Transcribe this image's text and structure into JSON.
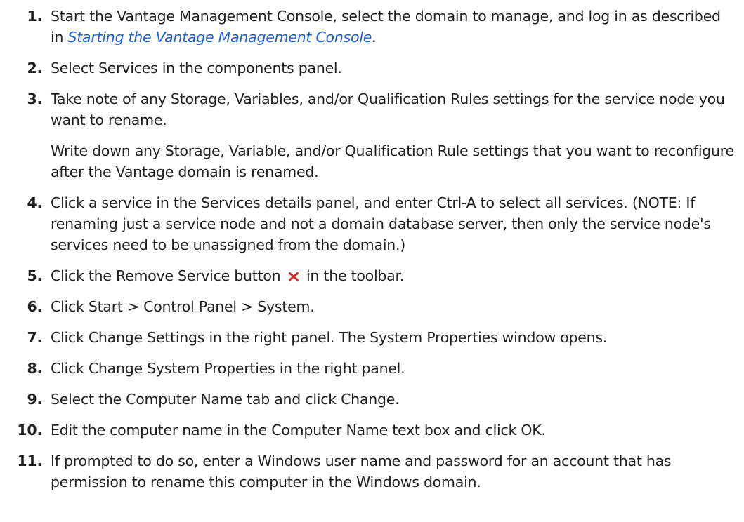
{
  "steps": [
    {
      "num": "1.",
      "text_before": "Start the Vantage Management Console, select the domain to manage, and log in as described in ",
      "link": "Starting the Vantage Management Console",
      "text_after": "."
    },
    {
      "num": "2.",
      "text": "Select Services in the components panel."
    },
    {
      "num": "3.",
      "text": "Take note of any Storage, Variables, and/or Qualification Rules settings for the service node you want to rename."
    },
    {
      "num": "",
      "note": "Write down any Storage, Variable, and/or Qualification Rule settings that you want to reconfigure after the Vantage domain is renamed."
    },
    {
      "num": "4.",
      "text": "Click a service in the Services details panel, and enter Ctrl-A to select all services. (NOTE: If renaming just a service node and not a domain database server, then only the service node's services need to be unassigned from the domain.)"
    },
    {
      "num": "5.",
      "text_before": "Click the Remove Service button",
      "icon": "remove-x-icon",
      "icon_color": "#d02a2a",
      "text_after": "in the toolbar."
    },
    {
      "num": "6.",
      "text": "Click Start > Control Panel > System."
    },
    {
      "num": "7.",
      "text": "Click Change Settings in the right panel. The System Properties window opens."
    },
    {
      "num": "8.",
      "text": "Click Change System Properties in the right panel."
    },
    {
      "num": "9.",
      "text": "Select the Computer Name tab and click Change."
    },
    {
      "num": "10.",
      "text": "Edit the computer name in the Computer Name text box and click OK."
    },
    {
      "num": "11.",
      "text": "If prompted to do so, enter a Windows user name and password for an account that has permission to rename this computer in the Windows domain."
    }
  ],
  "colors": {
    "link": "#1a5fd6",
    "text": "#231f20",
    "remove_icon": "#d02a2a"
  }
}
